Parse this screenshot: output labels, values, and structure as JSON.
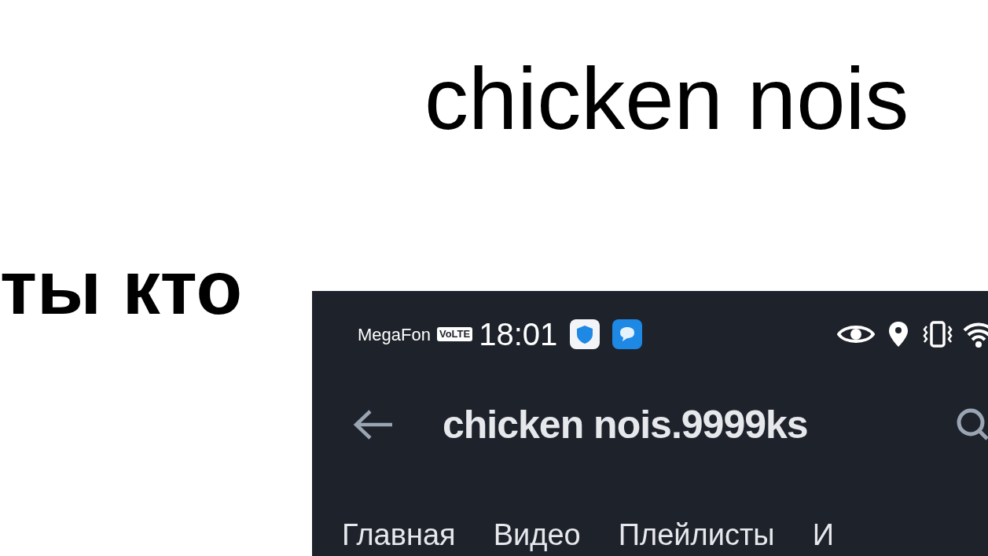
{
  "heading": "chicken nois",
  "caption": "ты кто",
  "phone": {
    "status_bar": {
      "carrier": "MegaFon",
      "network_badge": "VoLTE",
      "time": "18:01"
    },
    "header": {
      "title": "chicken nois.9999ks"
    },
    "tabs": [
      {
        "label": "Главная"
      },
      {
        "label": "Видео"
      },
      {
        "label": "Плейлисты"
      },
      {
        "label": "И"
      }
    ]
  }
}
